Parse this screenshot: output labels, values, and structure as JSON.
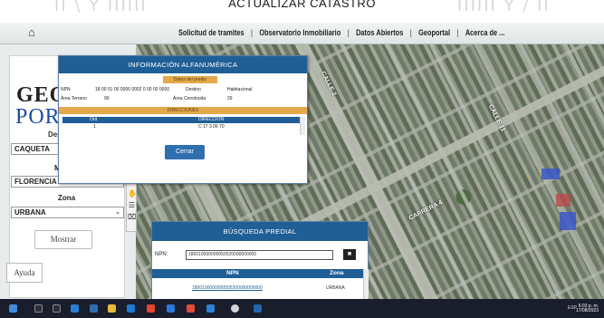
{
  "banner": {
    "title": "ACTUALIZAR CATASTRO",
    "watermark_left": "II \\ Y IIIIII",
    "watermark_right": "IIIIII Y / II"
  },
  "nav": {
    "home_icon": "home-icon",
    "items": [
      "Solicitud de tramites",
      "Observatorio Inmobiliario",
      "Datos Abiertos",
      "Geoportal",
      "Acerca de ..."
    ]
  },
  "left_panel": {
    "logo_line1": "GEO",
    "logo_line2": "POR",
    "department_label": "Dep",
    "department_value": "CAQUETA",
    "municipality_label": "M",
    "municipality_value": "FLORENCIA",
    "zone_label": "Zona",
    "zone_value": "URBANA",
    "show_button": "Mostrar",
    "help_button": "Ayuda"
  },
  "info_dialog": {
    "title": "INFORMACIÓN ALFANUMÉRICA",
    "section_predio": "Datos del predio",
    "npn_label": "NPN",
    "npn_value": "18 00 01 00 0006 0002 0 00 00 0000",
    "destino_label": "Destino",
    "destino_value": "Habitacional",
    "area_terreno_label": "Área Terreno",
    "area_terreno_value": "90",
    "area_construida_label": "Área Construida",
    "area_construida_value": "29",
    "section_direcciones": "DIRECCIONES",
    "col_ord": "Ord",
    "col_direccion": "DIRECCION",
    "row_ord": "1",
    "row_direccion": "C 17 3 09 70",
    "close_button": "Cerrar"
  },
  "search_dialog": {
    "title": "BÚSQUEDA PREDIAL",
    "npn_label": "NPN:",
    "npn_input_value": "180010000000050520000000000",
    "col_npn": "NPN",
    "col_zona": "Zona",
    "result_npn": "1800100000000505200000000000",
    "result_zona": "URBANA"
  },
  "map": {
    "street_labels": [
      "CALLE 2",
      "CALLE 11",
      "CARRERA 4"
    ]
  },
  "taskbar": {
    "tray_text": "ESP",
    "time": "6:03 p. m.",
    "date": "17/08/2023"
  },
  "colors": {
    "header_blue": "#1f5f96",
    "accent_orange": "#e3a94b",
    "logo_blue": "#1b4fa3",
    "taskbar": "#1a1d2b"
  }
}
